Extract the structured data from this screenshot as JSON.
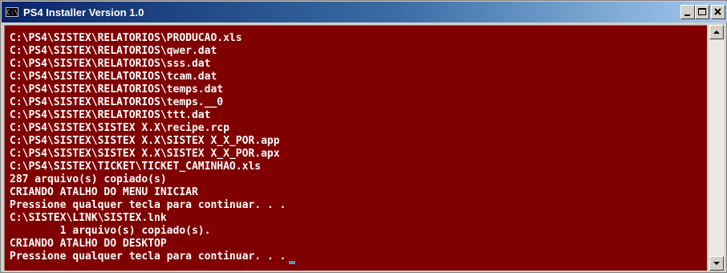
{
  "window": {
    "title": "PS4 Installer Version 1.0",
    "icon_label": "C:\\"
  },
  "title_buttons": {
    "minimize": "minimize-icon",
    "restore": "restore-icon",
    "close": "close-icon"
  },
  "console": {
    "background_color": "#800000",
    "text_color": "#ffffff",
    "lines": [
      "C:\\PS4\\SISTEX\\RELATORIOS\\PRODUCAO.xls",
      "C:\\PS4\\SISTEX\\RELATORIOS\\qwer.dat",
      "C:\\PS4\\SISTEX\\RELATORIOS\\sss.dat",
      "C:\\PS4\\SISTEX\\RELATORIOS\\tcam.dat",
      "C:\\PS4\\SISTEX\\RELATORIOS\\temps.dat",
      "C:\\PS4\\SISTEX\\RELATORIOS\\temps.__0",
      "C:\\PS4\\SISTEX\\RELATORIOS\\ttt.dat",
      "C:\\PS4\\SISTEX\\SISTEX X.X\\recipe.rcp",
      "C:\\PS4\\SISTEX\\SISTEX X.X\\SISTEX X_X_POR.app",
      "C:\\PS4\\SISTEX\\SISTEX X.X\\SISTEX X_X_POR.apx",
      "C:\\PS4\\SISTEX\\TICKET\\TICKET_CAMINHAO.xls",
      "287 arquivo(s) copiado(s)",
      "CRIANDO ATALHO DO MENU INICIAR",
      "Pressione qualquer tecla para continuar. . .",
      "C:\\SISTEX\\LINK\\SISTEX.lnk",
      "        1 arquivo(s) copiado(s).",
      "CRIANDO ATALHO DO DESKTOP",
      "Pressione qualquer tecla para continuar. . ."
    ]
  },
  "scrollbar": {
    "up_icon": "scroll-up-arrow-icon",
    "down_icon": "scroll-down-arrow-icon"
  }
}
